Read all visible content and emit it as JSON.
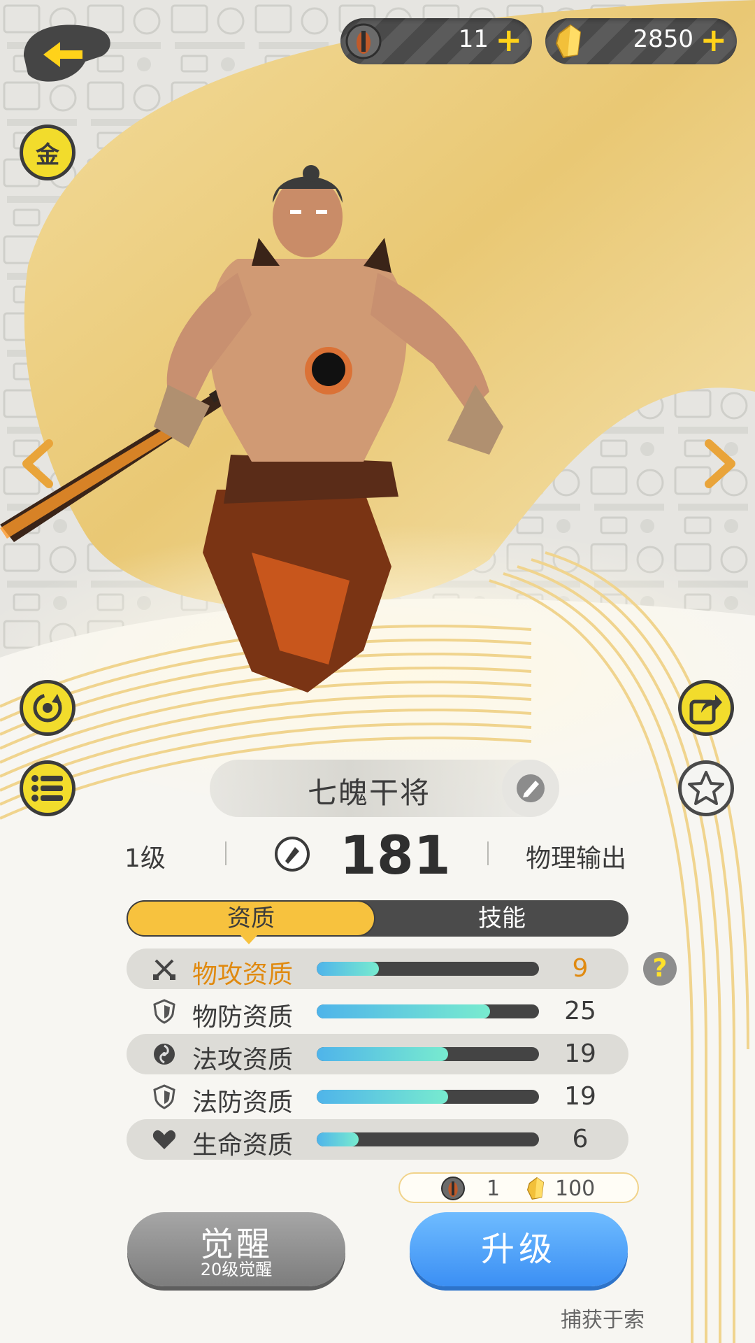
{
  "resources": {
    "spirit_orb": {
      "amount": "11",
      "plus": "+",
      "icon": "spirit-orb-icon"
    },
    "crystal": {
      "amount": "2850",
      "plus": "+",
      "icon": "gold-crystal-icon"
    }
  },
  "side_buttons": {
    "back": "back-arrow-icon",
    "gold": "金",
    "rotate": "rotate-icon",
    "list": "list-icon",
    "share": "share-icon",
    "favorite": "star-icon"
  },
  "hero": {
    "name": "七魄干将",
    "level": "1级",
    "power": "181",
    "role": "物理输出"
  },
  "tabs": {
    "qualification": "资质",
    "skills": "技能",
    "active": "资质"
  },
  "stats": [
    {
      "label": "物攻资质",
      "value": "9",
      "fill": 0.28,
      "icon": "crossed-swords-icon",
      "highlight": true
    },
    {
      "label": "物防资质",
      "value": "25",
      "fill": 0.78,
      "icon": "shield-icon",
      "highlight": false
    },
    {
      "label": "法攻资质",
      "value": "19",
      "fill": 0.59,
      "icon": "magic-orb-icon",
      "highlight": false
    },
    {
      "label": "法防资质",
      "value": "19",
      "fill": 0.59,
      "icon": "shield-icon",
      "highlight": false
    },
    {
      "label": "生命资质",
      "value": "6",
      "fill": 0.19,
      "icon": "heart-icon",
      "highlight": false
    }
  ],
  "help": "?",
  "cost": {
    "orb": "1",
    "crystal": "100"
  },
  "buttons": {
    "awaken": "觉醒",
    "awaken_sub": "20级觉醒",
    "upgrade": "升级"
  },
  "caught_text": "捕获于索",
  "colors": {
    "accent_yellow": "#f7c23e",
    "highlight_text": "#e08a10",
    "upgrade_blue": "#4a9cf7",
    "bar_start": "#4fb4ea",
    "bar_end": "#78ebcf"
  }
}
